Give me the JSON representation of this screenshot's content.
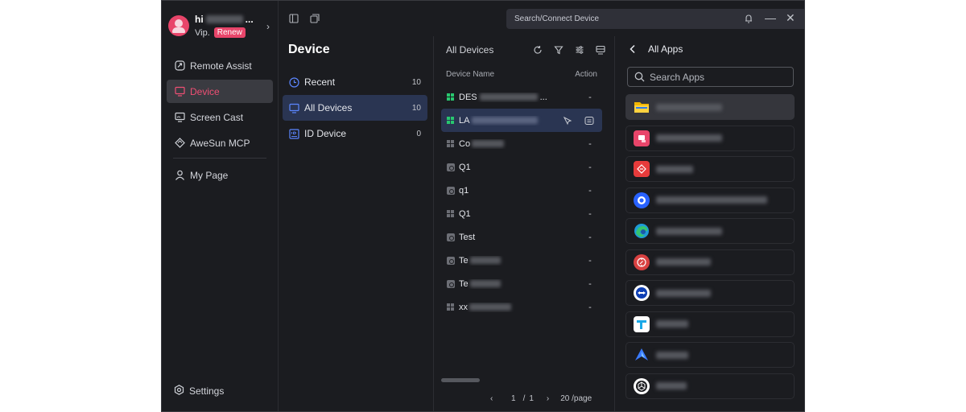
{
  "profile": {
    "name_visible": "hi",
    "name_suffix": "...",
    "vip_label": "Vip.",
    "renew_label": "Renew"
  },
  "sidebar": {
    "items": [
      {
        "label": "Remote Assist",
        "icon": "remote-assist-icon"
      },
      {
        "label": "Device",
        "icon": "monitor-icon",
        "active": true
      },
      {
        "label": "Screen Cast",
        "icon": "screen-cast-icon"
      },
      {
        "label": "AweSun MCP",
        "icon": "mcp-icon"
      },
      {
        "label": "My Page",
        "icon": "user-icon"
      }
    ],
    "settings_label": "Settings"
  },
  "topbar": {
    "search_placeholder": "Search/Connect Device"
  },
  "categories": {
    "title": "Device",
    "items": [
      {
        "label": "Recent",
        "count": "10",
        "icon": "clock-icon"
      },
      {
        "label": "All Devices",
        "count": "10",
        "icon": "monitor-icon",
        "active": true
      },
      {
        "label": "ID Device",
        "count": "0",
        "icon": "id-icon"
      }
    ]
  },
  "devices": {
    "title": "All Devices",
    "col_name": "Device Name",
    "col_action": "Action",
    "rows": [
      {
        "name": "DES",
        "suffix": "...",
        "os": "windows",
        "action": "-"
      },
      {
        "name": "LA",
        "os": "windows",
        "action": "",
        "active": true
      },
      {
        "name": "Co",
        "os": "windows-gray",
        "action": "-"
      },
      {
        "name": "Q1",
        "os": "generic",
        "action": "-"
      },
      {
        "name": "q1",
        "os": "generic",
        "action": "-"
      },
      {
        "name": "Q1",
        "os": "windows-gray",
        "action": "-"
      },
      {
        "name": "Test",
        "os": "generic",
        "action": "-"
      },
      {
        "name": "Te",
        "os": "generic",
        "action": "-"
      },
      {
        "name": "Te",
        "os": "generic",
        "action": "-"
      },
      {
        "name": "xx",
        "os": "windows-gray",
        "action": "-"
      }
    ],
    "pager": {
      "prev": "‹",
      "current": "1",
      "sep": "/",
      "total": "1",
      "next": "›",
      "page_size": "20 /page"
    }
  },
  "apps": {
    "title": "All Apps",
    "search_placeholder": "Search Apps",
    "items": [
      {
        "icon": "folder-icon",
        "color": "#f2b600"
      },
      {
        "icon": "app-red-icon",
        "color": "#e8456a"
      },
      {
        "icon": "app-red-arrow-icon",
        "color": "#e63b3b"
      },
      {
        "icon": "app-blue-circle-icon",
        "color": "#2962ff"
      },
      {
        "icon": "edge-icon",
        "color": "#1e9bd7"
      },
      {
        "icon": "app-red-compass-icon",
        "color": "#d94141"
      },
      {
        "icon": "teamviewer-icon",
        "color": "#0e3fb5"
      },
      {
        "icon": "app-cyan-icon",
        "color": "#1aa9e8"
      },
      {
        "icon": "app-blue-arrow-icon",
        "color": "#3a7bff"
      },
      {
        "icon": "unity-icon",
        "color": "#ffffff"
      }
    ]
  }
}
